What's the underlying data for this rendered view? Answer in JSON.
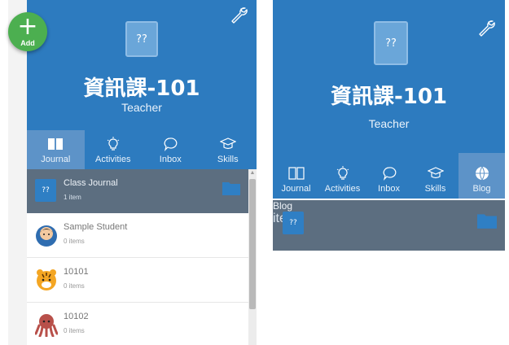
{
  "add_button": {
    "icon": "plus-icon",
    "label": "Add"
  },
  "left": {
    "logo_glyph": "??",
    "class_name": "資訊課-101",
    "role": "Teacher",
    "tabs": [
      {
        "label": "Journal",
        "icon": "book-icon",
        "active": true
      },
      {
        "label": "Activities",
        "icon": "lightbulb-icon",
        "active": false
      },
      {
        "label": "Inbox",
        "icon": "chat-bubble-icon",
        "active": false
      },
      {
        "label": "Skills",
        "icon": "graduation-cap-icon",
        "active": false
      }
    ],
    "items": [
      {
        "name": "Class Journal",
        "sub": "1 item",
        "kind": "class-icon",
        "selected": true
      },
      {
        "name": "Sample Student",
        "sub": "0 items",
        "kind": "student-avatar",
        "selected": false
      },
      {
        "name": "10101",
        "sub": "0 items",
        "kind": "tiger-avatar",
        "selected": false
      },
      {
        "name": "10102",
        "sub": "0 items",
        "kind": "octopus-avatar",
        "selected": false
      }
    ]
  },
  "right": {
    "logo_glyph": "??",
    "class_name": "資訊課-101",
    "role": "Teacher",
    "tabs": [
      {
        "label": "Journal",
        "icon": "book-icon",
        "active": false
      },
      {
        "label": "Activities",
        "icon": "lightbulb-icon",
        "active": false
      },
      {
        "label": "Inbox",
        "icon": "chat-bubble-icon",
        "active": false
      },
      {
        "label": "Skills",
        "icon": "graduation-cap-icon",
        "active": false
      },
      {
        "label": "Blog",
        "icon": "globe-icon",
        "active": true
      }
    ],
    "items": [
      {
        "name": "Blog",
        "sub": "items",
        "glyph": "??",
        "selected": true
      }
    ]
  },
  "colors": {
    "header": "#2d7bbf",
    "active_tab": "#5d93c8",
    "selected_row": "#5c6e80",
    "add": "#4caf50"
  }
}
